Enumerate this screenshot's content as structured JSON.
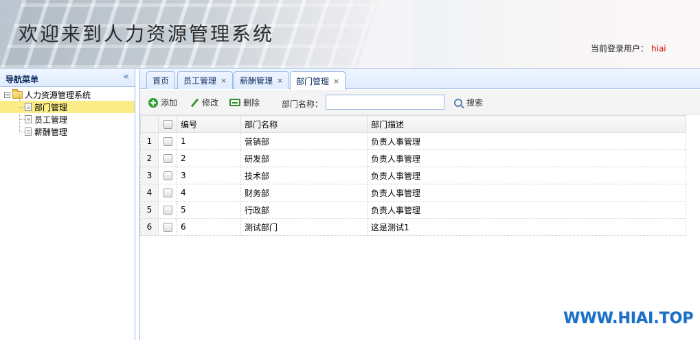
{
  "header": {
    "title": "欢迎来到人力资源管理系统",
    "user_label": "当前登录用户：",
    "user_name": "hiai"
  },
  "nav": {
    "title": "导航菜单",
    "collapse_icon": "double-chevron-left-icon",
    "root": "人力资源管理系统",
    "items": [
      {
        "label": "部门管理",
        "selected": true
      },
      {
        "label": "员工管理",
        "selected": false
      },
      {
        "label": "薪酬管理",
        "selected": false
      }
    ]
  },
  "tabs": [
    {
      "label": "首页",
      "closable": false,
      "active": false
    },
    {
      "label": "员工管理",
      "closable": true,
      "active": false
    },
    {
      "label": "薪酬管理",
      "closable": true,
      "active": false
    },
    {
      "label": "部门管理",
      "closable": true,
      "active": true
    }
  ],
  "toolbar": {
    "add_label": "添加",
    "edit_label": "修改",
    "delete_label": "删除",
    "search_label": "部门名称：",
    "search_value": "",
    "search_button": "搜索"
  },
  "grid": {
    "columns": [
      "编号",
      "部门名称",
      "部门描述"
    ],
    "rows": [
      {
        "rn": "1",
        "id": "1",
        "name": "营销部",
        "desc": "负责人事管理"
      },
      {
        "rn": "2",
        "id": "2",
        "name": "研发部",
        "desc": "负责人事管理"
      },
      {
        "rn": "3",
        "id": "3",
        "name": "技术部",
        "desc": "负责人事管理"
      },
      {
        "rn": "4",
        "id": "4",
        "name": "财务部",
        "desc": "负责人事管理"
      },
      {
        "rn": "5",
        "id": "5",
        "name": "行政部",
        "desc": "负责人事管理"
      },
      {
        "rn": "6",
        "id": "6",
        "name": "测试部门",
        "desc": "这是测试1"
      }
    ]
  },
  "watermark": "WWW.HIAI.TOP",
  "colors": {
    "border": "#95b8e7",
    "selected": "#fbec88",
    "user_name": "#cc0000",
    "watermark": "#1b6fc4"
  }
}
